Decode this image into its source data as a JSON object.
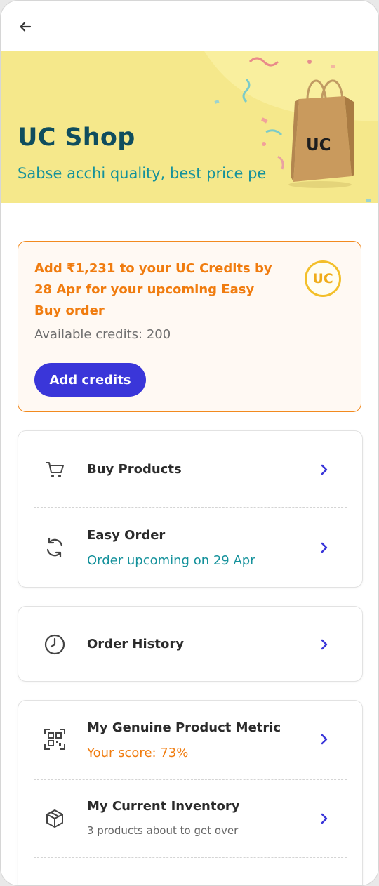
{
  "header": {
    "back_icon": "arrow-left-icon"
  },
  "banner": {
    "title": "UC Shop",
    "subtitle": "Sabse acchi quality, best price pe",
    "bag_label": "UC",
    "background": "#f5e88b"
  },
  "credits": {
    "message": "Add ₹1,231 to your UC Credits by 28 Apr for your upcoming Easy Buy order",
    "available": "Available credits: 200",
    "coin_label": "UC",
    "button_label": "Add credits",
    "accent": "#f07c0f",
    "button_color": "#3a36d9"
  },
  "menu": {
    "buy_products": {
      "title": "Buy Products",
      "icon": "cart-icon"
    },
    "easy_order": {
      "title": "Easy Order",
      "subtitle": "Order upcoming on 29 Apr",
      "icon": "refresh-icon"
    },
    "order_history": {
      "title": "Order History",
      "icon": "clock-icon"
    },
    "genuine_metric": {
      "title": "My Genuine Product Metric",
      "subtitle": "Your score: 73%",
      "icon": "qr-code-icon"
    },
    "inventory": {
      "title": "My Current Inventory",
      "subtitle": "3 products about to get over",
      "icon": "box-icon"
    }
  }
}
